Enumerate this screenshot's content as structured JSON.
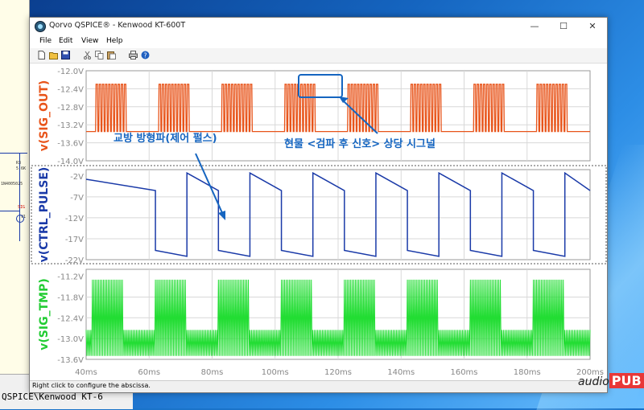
{
  "window": {
    "title": "Qorvo QSPICE® - Kenwood KT-600T",
    "controls": {
      "minimize": "—",
      "maximize": "☐",
      "close": "✕"
    }
  },
  "menu": [
    "File",
    "Edit",
    "View",
    "Help"
  ],
  "toolbar_icons": [
    "new-icon",
    "open-icon",
    "save-icon",
    "cut-icon",
    "copy-icon",
    "paste-icon",
    "print-icon",
    "help-icon"
  ],
  "status_text": "Right click to configure the abscissa.",
  "background_window": {
    "taskbar_text": "QSPICE\\Kenwood KT-6",
    "labels": [
      "R3",
      "5.6K",
      "1N4005025",
      "V1",
      "SIG"
    ]
  },
  "watermark": {
    "prefix": "audio",
    "brand": "PUB"
  },
  "annotations": {
    "top": "현물 <검파 후 신호> 상당 시그널",
    "middle": "교방 방형파(제어 펄스)"
  },
  "colors": {
    "sig_out": "#e8541a",
    "ctrl_pulse": "#1a3aa8",
    "sig_tmp": "#22dd33",
    "annotation": "#1565c0"
  },
  "chart_data": [
    {
      "type": "line",
      "title": "v(SIG_OUT)",
      "ylabel": "v(SIG_OUT)",
      "yticks": [
        "-12.0V",
        "-12.4V",
        "-12.8V",
        "-13.2V",
        "-13.6V",
        "-14.0V"
      ],
      "ylim": [
        -14.0,
        -12.0
      ],
      "xlim": [
        40,
        200
      ],
      "description_values": {
        "baseline": -13.35,
        "burst_high": -12.3,
        "burst_low": -13.35,
        "period_ms": 20,
        "burst_start_offset_ms": 3,
        "burst_width_ms": 10,
        "cycles_per_burst": 10
      },
      "color": "#e8541a"
    },
    {
      "type": "line",
      "title": "v(CTRL_PULSE)",
      "ylabel": "v(CTRL_PULSE)",
      "yticks": [
        "-2V",
        "-7V",
        "-12V",
        "-17V",
        "-22V"
      ],
      "ylim": [
        -22,
        -0.5
      ],
      "xlim": [
        40,
        200
      ],
      "description_values": {
        "period_ms": 20,
        "first_edge_ms": 62,
        "high_start": -1.3,
        "high_end": -5.5,
        "low_start": -19.8,
        "low_end": -21.2
      },
      "color": "#1a3aa8"
    },
    {
      "type": "line",
      "title": "v(SIG_TMP)",
      "ylabel": "v(SIG_TMP)",
      "xlabel_ticks": [
        "40ms",
        "60ms",
        "80ms",
        "100ms",
        "120ms",
        "140ms",
        "160ms",
        "180ms",
        "200ms"
      ],
      "yticks": [
        "-11.2V",
        "-11.8V",
        "-12.4V",
        "-13.0V",
        "-13.6V"
      ],
      "ylim": [
        -13.6,
        -11.0
      ],
      "xlim": [
        40,
        200
      ],
      "description_values": {
        "period_ms": 20,
        "burst_high": -11.3,
        "burst_low": -13.5,
        "idle_high": -12.75,
        "idle_low": -13.5
      },
      "color": "#22dd33"
    }
  ]
}
